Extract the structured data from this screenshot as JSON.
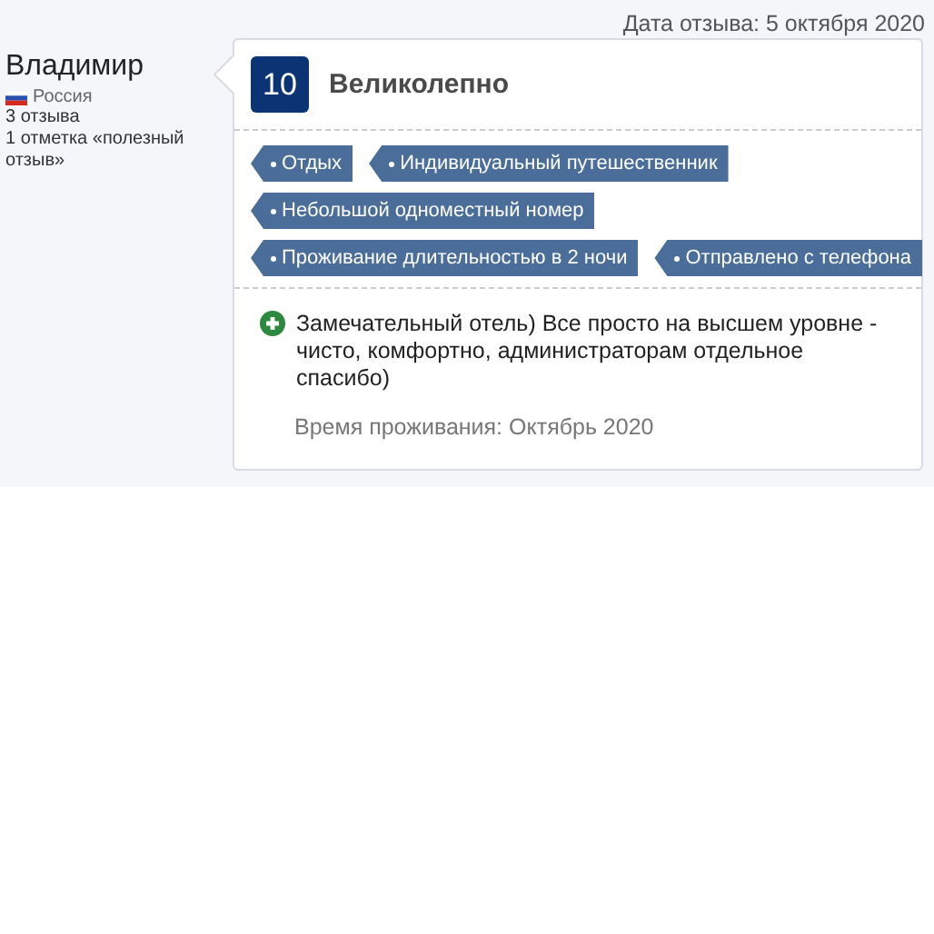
{
  "review_date": "Дата отзыва: 5 октября 2020",
  "reviewer": {
    "name": "Владимир",
    "country": "Россия",
    "reviews": "3 отзыва",
    "helpful": "1 отметка «полезный отзыв»"
  },
  "review": {
    "score": "10",
    "verdict": "Великолепно",
    "tag_rows": [
      [
        "Отдых",
        "Индивидуальный путешественник"
      ],
      [
        "Небольшой одноместный номер"
      ],
      [
        "Проживание длительностью в 2 ночи",
        "Отправлено с телефона"
      ]
    ],
    "positive": "Замечательный отель) Все просто на высшем уровне - чисто, комфортно, администраторам отдельное спасибо)",
    "stay": "Время проживания: Октябрь 2020"
  }
}
